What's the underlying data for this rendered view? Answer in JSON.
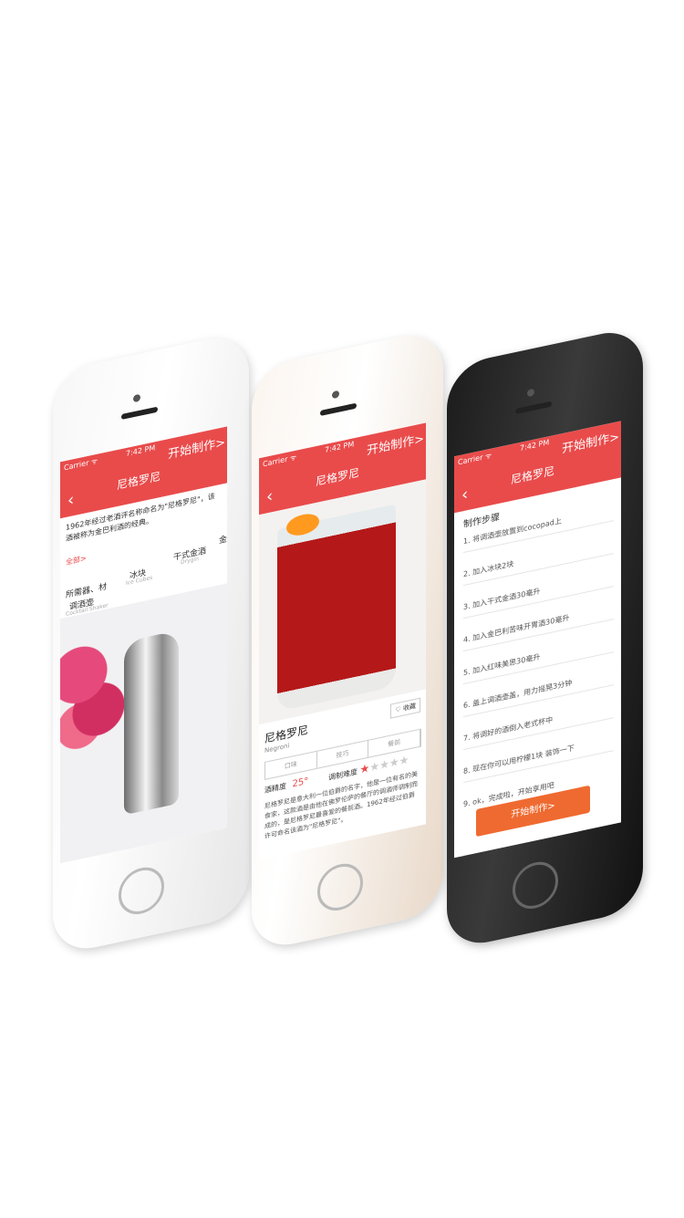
{
  "phone1": {
    "status": "Carrier ᯤ",
    "time": "7:42 PM",
    "title": "尼格罗尼",
    "start": "开始制作>",
    "desc": "1962年经过老酒评名称命名为\"尼格罗尼\"，该酒被称为金巴利酒的经典。",
    "all": "全部>",
    "tools": [
      {
        "cn": "所需器、材",
        "en": ""
      },
      {
        "cn": "调酒壶",
        "en": "Cocktail Shaker"
      },
      {
        "cn": "冰块",
        "en": "Ice Cubes"
      },
      {
        "cn": "干式金酒",
        "en": "Drygin"
      },
      {
        "cn": "金",
        "en": ""
      }
    ]
  },
  "phone2": {
    "status": "Carrier ᯤ",
    "time": "7:42 PM",
    "title": "尼格罗尼",
    "start": "开始制作>",
    "name_cn": "尼格罗尼",
    "name_en": "Negroni",
    "fav": "收藏",
    "tabs": [
      "口味",
      "技巧",
      "餐前"
    ],
    "alcohol_label": "酒精度",
    "alcohol_value": "25°",
    "difficulty_label": "调制难度",
    "difficulty": 1,
    "difficulty_max": 5,
    "desc": "尼格罗尼是意大利一位伯爵的名字，他是一位有名的美食家，这款酒是由他在佛罗伦萨的餐厅的调酒师调制而成的，是尼格罗尼最喜爱的餐前酒。1962年经过伯爵许可命名该酒为\"尼格罗尼\"。"
  },
  "phone3": {
    "status": "Carrier ᯤ",
    "time": "7:42 PM",
    "title": "尼格罗尼",
    "start": "开始制作>",
    "steps_title": "制作步骤",
    "steps": [
      "1. 将调酒壶放置到cocopad上",
      "2. 加入冰块2块",
      "3. 加入干式金酒30毫升",
      "4. 加入金巴利苦味开胃酒30毫升",
      "5. 加入红味美思30毫升",
      "6. 盖上调酒壶盖，用力摇晃3分钟",
      "7. 将调好的酒倒入老式杯中",
      "8. 现在你可以用柠檬1块 装饰一下",
      "9. ok，完成啦，开始享用吧"
    ],
    "button": "开始制作>"
  },
  "colors": {
    "accent": "#e94b4b",
    "button": "#ef6a30"
  }
}
